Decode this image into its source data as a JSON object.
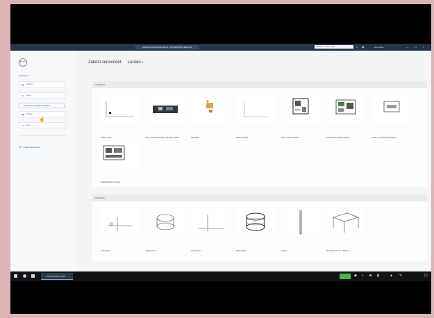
{
  "window": {
    "title": "AutoCAD Architecture 2018 - STUDENTENVERSION",
    "search_placeholder": "Stichwort oder Frage",
    "user": "Anmelden"
  },
  "sidebar": {
    "back_icon": "circle-arrow-left-icon",
    "heading": "MODELLE",
    "items": [
      {
        "label": "Öffnen"
      },
      {
        "label": "Neu..."
      },
      {
        "label": "Öffnen"
      },
      {
        "label": "Neu..."
      }
    ],
    "new_button": "Zeichnung / Projekt erstellen",
    "recent": "Zuletzt verwendet"
  },
  "main": {
    "heading": "Zuletzt verwendet",
    "learn": "Lernen ›",
    "sections": [
      {
        "title": "MODELLE",
        "items": [
          "Zeichnung1",
          "Lab_Übungsmodell_Gebäude_2022",
          "Möbel03",
          "Zeichnung02",
          "Mein erstes Modell",
          "Architektur-Engineering1",
          "UG01_Grundriss_Beispiel",
          "Gebäudeplan-Layout"
        ]
      },
      {
        "title": "FAMILIEN",
        "items": [
          "Achsraster",
          "Zylinder01",
          "Achskreuz",
          "Zylinder02",
          "Stütze",
          "Beistelltisch mit 4 Beinen"
        ]
      }
    ]
  },
  "taskbar": {
    "app_label": "AutoCAD Arch 2018"
  }
}
